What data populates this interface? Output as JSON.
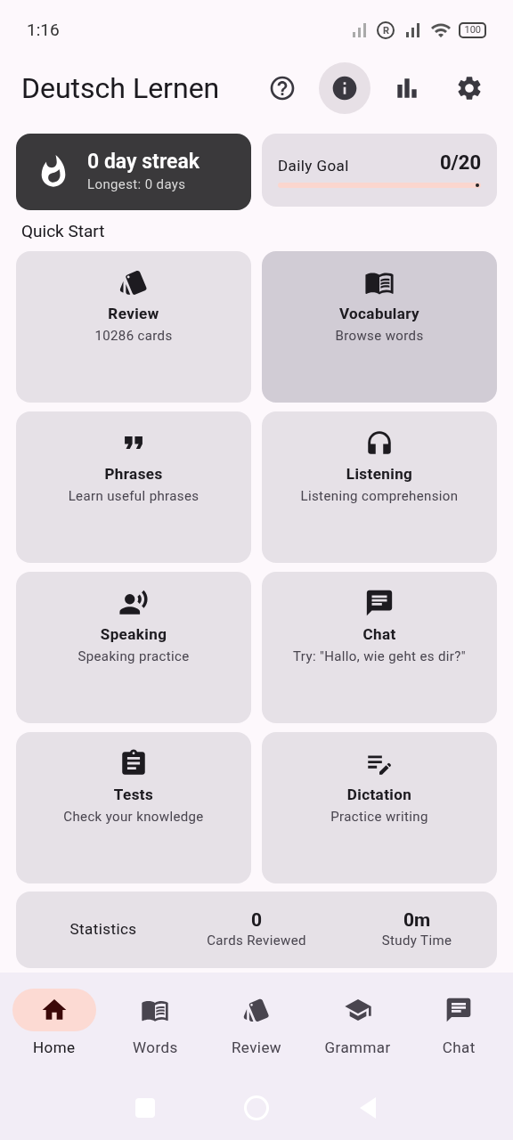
{
  "status_bar": {
    "time": "1:16",
    "battery": "100",
    "roaming": "R"
  },
  "header": {
    "title": "Deutsch Lernen",
    "actions": [
      {
        "kind": "help",
        "highlighted": false
      },
      {
        "kind": "info",
        "highlighted": true
      },
      {
        "kind": "stats",
        "highlighted": false
      },
      {
        "kind": "settings",
        "highlighted": false
      }
    ]
  },
  "streak": {
    "title": "0 day streak",
    "subtitle": "Longest: 0 days"
  },
  "daily_goal": {
    "label": "Daily Goal",
    "value": "0/20",
    "level": 0
  },
  "section_title": "Quick Start",
  "tiles": [
    {
      "kind": "review",
      "title": "Review",
      "subtitle": "10286 cards",
      "highlighted": false
    },
    {
      "kind": "vocabulary",
      "title": "Vocabulary",
      "subtitle": "Browse words",
      "highlighted": true
    },
    {
      "kind": "phrases",
      "title": "Phrases",
      "subtitle": "Learn useful phrases",
      "highlighted": false
    },
    {
      "kind": "listening",
      "title": "Listening",
      "subtitle": "Listening comprehension",
      "highlighted": false
    },
    {
      "kind": "speaking",
      "title": "Speaking",
      "subtitle": "Speaking practice",
      "highlighted": false
    },
    {
      "kind": "chat",
      "title": "Chat",
      "subtitle": "Try: \"Hallo, wie geht es dir?\"",
      "highlighted": false
    },
    {
      "kind": "tests",
      "title": "Tests",
      "subtitle": "Check your knowledge",
      "highlighted": false
    },
    {
      "kind": "dictation",
      "title": "Dictation",
      "subtitle": "Practice writing",
      "highlighted": false
    }
  ],
  "statistics": {
    "label": "Statistics",
    "items": [
      {
        "value": "0",
        "label": "Cards Reviewed"
      },
      {
        "value": "0m",
        "label": "Study Time"
      }
    ]
  },
  "bottom_nav": [
    {
      "kind": "home",
      "label": "Home",
      "selected": true
    },
    {
      "kind": "words",
      "label": "Words",
      "selected": false
    },
    {
      "kind": "review",
      "label": "Review",
      "selected": false
    },
    {
      "kind": "grammar",
      "label": "Grammar",
      "selected": false
    },
    {
      "kind": "chat",
      "label": "Chat",
      "selected": false
    }
  ]
}
